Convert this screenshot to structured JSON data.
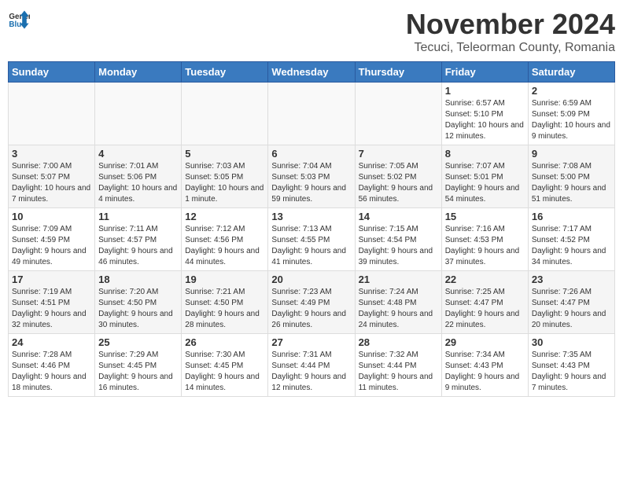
{
  "logo": {
    "general": "General",
    "blue": "Blue"
  },
  "title": "November 2024",
  "location": "Tecuci, Teleorman County, Romania",
  "days_of_week": [
    "Sunday",
    "Monday",
    "Tuesday",
    "Wednesday",
    "Thursday",
    "Friday",
    "Saturday"
  ],
  "weeks": [
    [
      {
        "day": "",
        "info": ""
      },
      {
        "day": "",
        "info": ""
      },
      {
        "day": "",
        "info": ""
      },
      {
        "day": "",
        "info": ""
      },
      {
        "day": "",
        "info": ""
      },
      {
        "day": "1",
        "info": "Sunrise: 6:57 AM\nSunset: 5:10 PM\nDaylight: 10 hours and 12 minutes."
      },
      {
        "day": "2",
        "info": "Sunrise: 6:59 AM\nSunset: 5:09 PM\nDaylight: 10 hours and 9 minutes."
      }
    ],
    [
      {
        "day": "3",
        "info": "Sunrise: 7:00 AM\nSunset: 5:07 PM\nDaylight: 10 hours and 7 minutes."
      },
      {
        "day": "4",
        "info": "Sunrise: 7:01 AM\nSunset: 5:06 PM\nDaylight: 10 hours and 4 minutes."
      },
      {
        "day": "5",
        "info": "Sunrise: 7:03 AM\nSunset: 5:05 PM\nDaylight: 10 hours and 1 minute."
      },
      {
        "day": "6",
        "info": "Sunrise: 7:04 AM\nSunset: 5:03 PM\nDaylight: 9 hours and 59 minutes."
      },
      {
        "day": "7",
        "info": "Sunrise: 7:05 AM\nSunset: 5:02 PM\nDaylight: 9 hours and 56 minutes."
      },
      {
        "day": "8",
        "info": "Sunrise: 7:07 AM\nSunset: 5:01 PM\nDaylight: 9 hours and 54 minutes."
      },
      {
        "day": "9",
        "info": "Sunrise: 7:08 AM\nSunset: 5:00 PM\nDaylight: 9 hours and 51 minutes."
      }
    ],
    [
      {
        "day": "10",
        "info": "Sunrise: 7:09 AM\nSunset: 4:59 PM\nDaylight: 9 hours and 49 minutes."
      },
      {
        "day": "11",
        "info": "Sunrise: 7:11 AM\nSunset: 4:57 PM\nDaylight: 9 hours and 46 minutes."
      },
      {
        "day": "12",
        "info": "Sunrise: 7:12 AM\nSunset: 4:56 PM\nDaylight: 9 hours and 44 minutes."
      },
      {
        "day": "13",
        "info": "Sunrise: 7:13 AM\nSunset: 4:55 PM\nDaylight: 9 hours and 41 minutes."
      },
      {
        "day": "14",
        "info": "Sunrise: 7:15 AM\nSunset: 4:54 PM\nDaylight: 9 hours and 39 minutes."
      },
      {
        "day": "15",
        "info": "Sunrise: 7:16 AM\nSunset: 4:53 PM\nDaylight: 9 hours and 37 minutes."
      },
      {
        "day": "16",
        "info": "Sunrise: 7:17 AM\nSunset: 4:52 PM\nDaylight: 9 hours and 34 minutes."
      }
    ],
    [
      {
        "day": "17",
        "info": "Sunrise: 7:19 AM\nSunset: 4:51 PM\nDaylight: 9 hours and 32 minutes."
      },
      {
        "day": "18",
        "info": "Sunrise: 7:20 AM\nSunset: 4:50 PM\nDaylight: 9 hours and 30 minutes."
      },
      {
        "day": "19",
        "info": "Sunrise: 7:21 AM\nSunset: 4:50 PM\nDaylight: 9 hours and 28 minutes."
      },
      {
        "day": "20",
        "info": "Sunrise: 7:23 AM\nSunset: 4:49 PM\nDaylight: 9 hours and 26 minutes."
      },
      {
        "day": "21",
        "info": "Sunrise: 7:24 AM\nSunset: 4:48 PM\nDaylight: 9 hours and 24 minutes."
      },
      {
        "day": "22",
        "info": "Sunrise: 7:25 AM\nSunset: 4:47 PM\nDaylight: 9 hours and 22 minutes."
      },
      {
        "day": "23",
        "info": "Sunrise: 7:26 AM\nSunset: 4:47 PM\nDaylight: 9 hours and 20 minutes."
      }
    ],
    [
      {
        "day": "24",
        "info": "Sunrise: 7:28 AM\nSunset: 4:46 PM\nDaylight: 9 hours and 18 minutes."
      },
      {
        "day": "25",
        "info": "Sunrise: 7:29 AM\nSunset: 4:45 PM\nDaylight: 9 hours and 16 minutes."
      },
      {
        "day": "26",
        "info": "Sunrise: 7:30 AM\nSunset: 4:45 PM\nDaylight: 9 hours and 14 minutes."
      },
      {
        "day": "27",
        "info": "Sunrise: 7:31 AM\nSunset: 4:44 PM\nDaylight: 9 hours and 12 minutes."
      },
      {
        "day": "28",
        "info": "Sunrise: 7:32 AM\nSunset: 4:44 PM\nDaylight: 9 hours and 11 minutes."
      },
      {
        "day": "29",
        "info": "Sunrise: 7:34 AM\nSunset: 4:43 PM\nDaylight: 9 hours and 9 minutes."
      },
      {
        "day": "30",
        "info": "Sunrise: 7:35 AM\nSunset: 4:43 PM\nDaylight: 9 hours and 7 minutes."
      }
    ]
  ]
}
